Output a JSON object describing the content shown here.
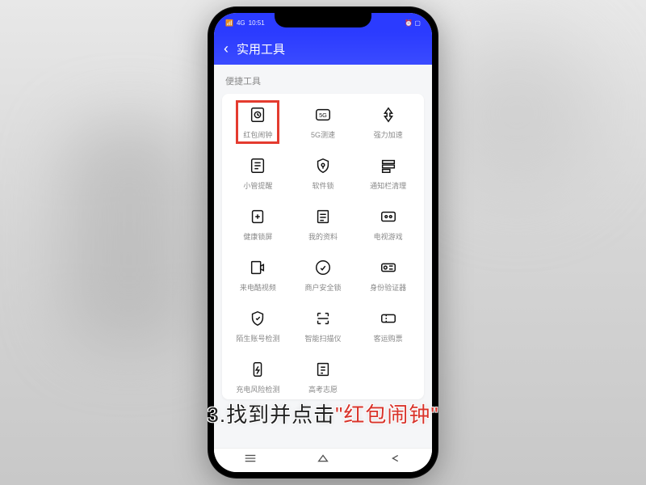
{
  "status": {
    "time": "10:51",
    "left_indicators": "4G",
    "right_indicators": "⏰ ▢"
  },
  "header": {
    "title": "实用工具"
  },
  "section": {
    "label": "便捷工具"
  },
  "tools": [
    {
      "label": "红包闹钟",
      "highlighted": true
    },
    {
      "label": "5G测速"
    },
    {
      "label": "强力加速"
    },
    {
      "label": "小管提醒"
    },
    {
      "label": "软件锁"
    },
    {
      "label": "通知栏清理"
    },
    {
      "label": "健康锁屏"
    },
    {
      "label": "我的资料"
    },
    {
      "label": "电视游戏"
    },
    {
      "label": "来电酷视频"
    },
    {
      "label": "商户安全锁"
    },
    {
      "label": "身份验证器"
    },
    {
      "label": "陌生账号检测"
    },
    {
      "label": "智能扫描仪"
    },
    {
      "label": "客运购票"
    },
    {
      "label": "充电风险检测"
    },
    {
      "label": "高考志愿"
    }
  ],
  "caption": {
    "prefix": "3.找到并点击",
    "quoted": "\"红包闹钟\""
  }
}
